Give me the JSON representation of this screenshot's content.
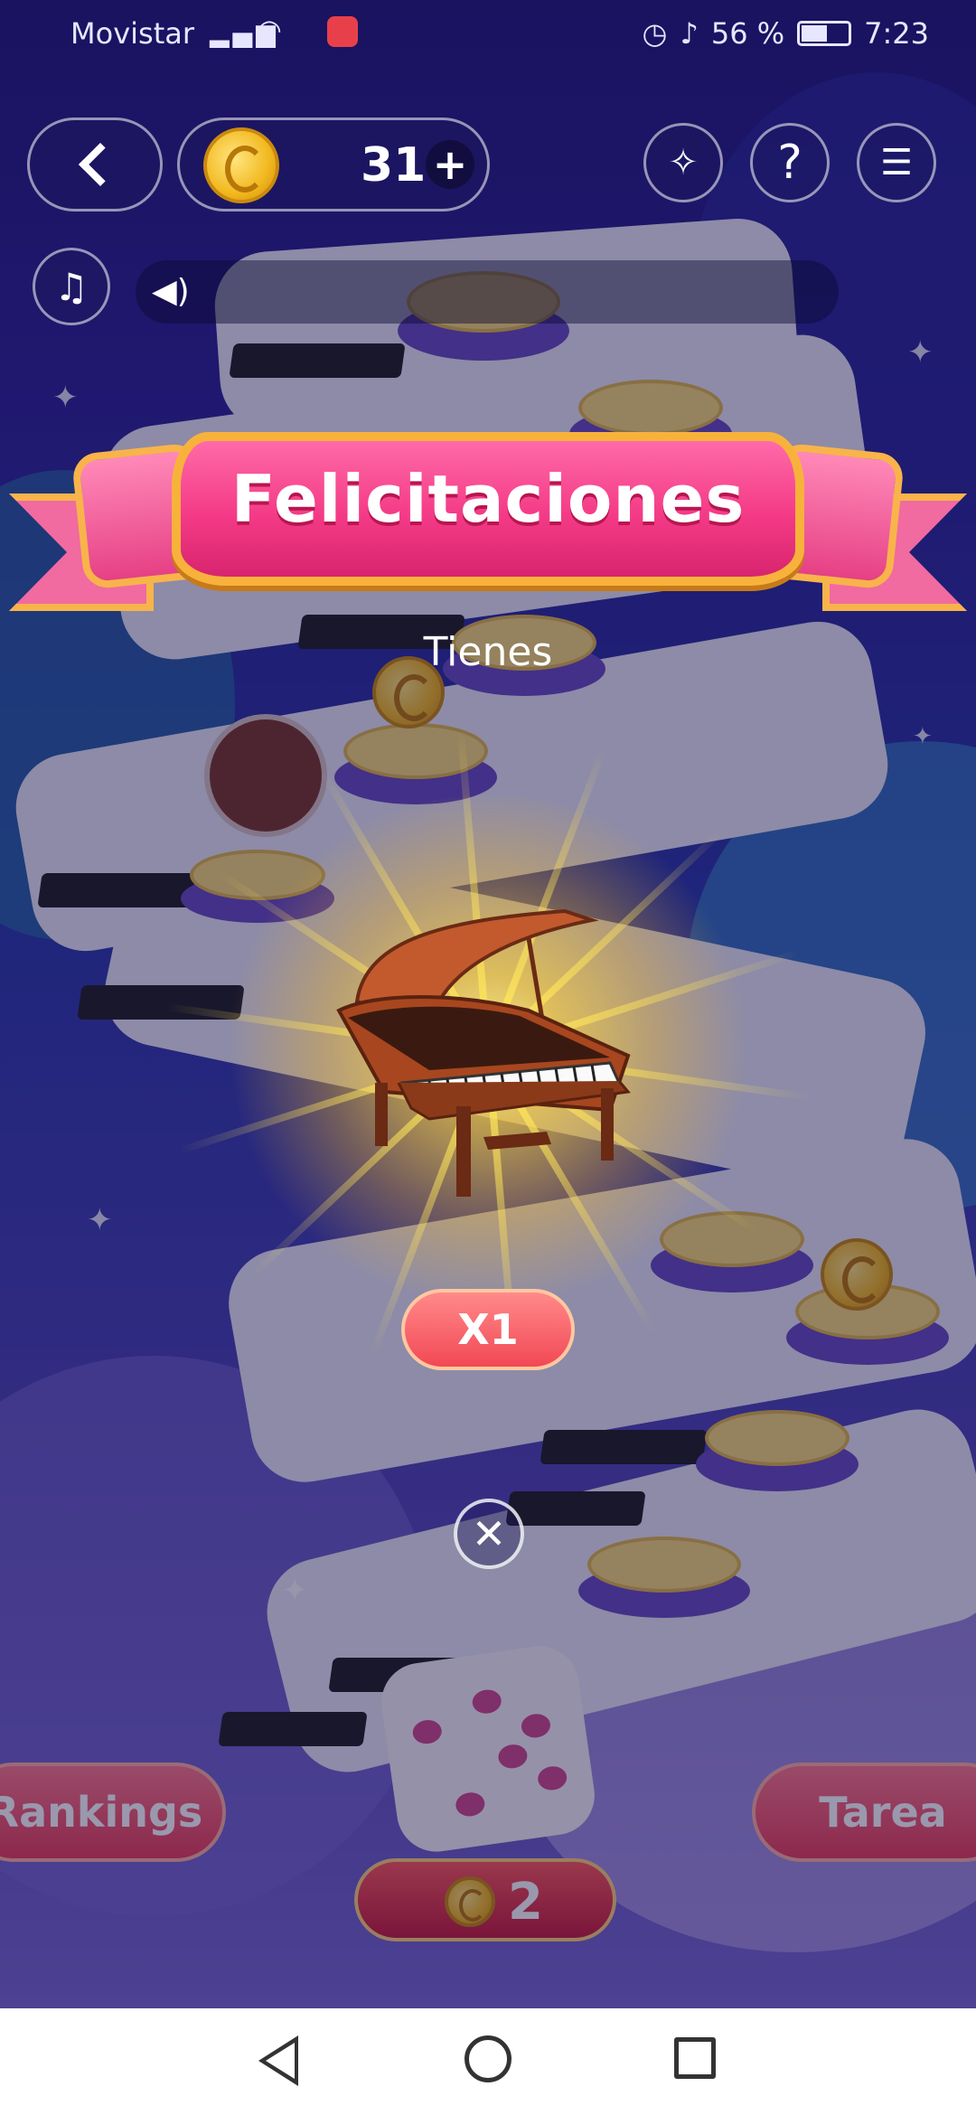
{
  "status_bar": {
    "carrier": "Movistar",
    "battery": "56 %",
    "battery_level": 0.56,
    "time": "7:23"
  },
  "top_bar": {
    "coins": "31"
  },
  "modal": {
    "title": "Felicitaciones",
    "subtitle": "Tienes",
    "reward_item": "grand-piano",
    "reward_quantity": "X1"
  },
  "bottom_bar": {
    "rankings_label": "Rankings",
    "task_label": "Tarea",
    "roll_cost": "2"
  },
  "colors": {
    "banner_pink": "#f43a86",
    "banner_gold": "#f8b23c",
    "badge_red": "#f24855"
  }
}
